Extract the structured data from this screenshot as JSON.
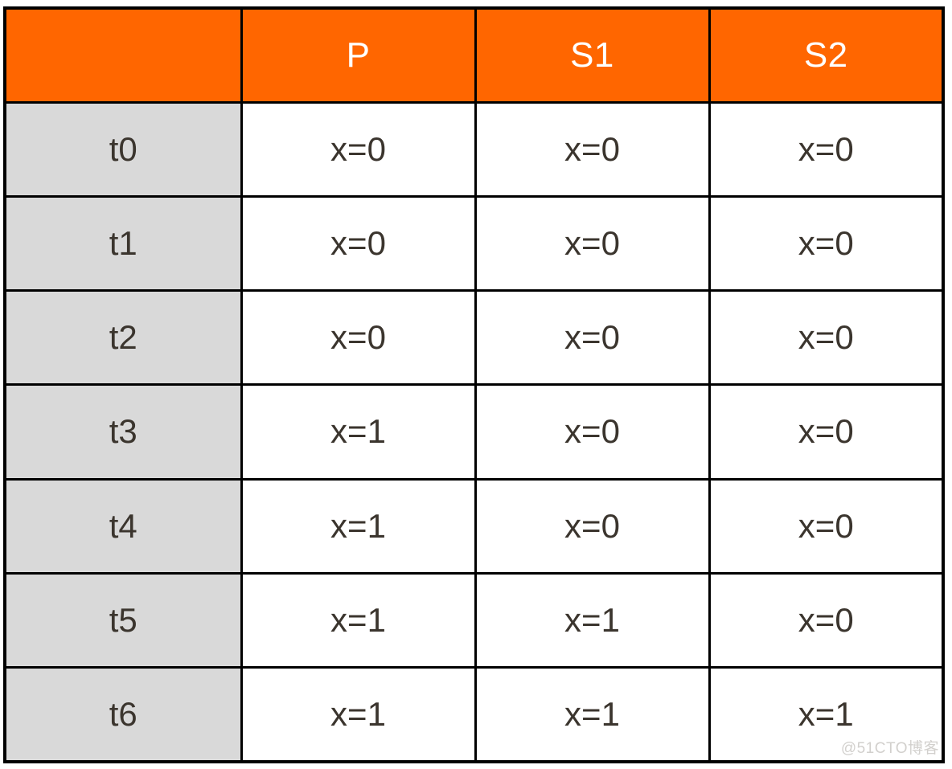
{
  "table": {
    "corner_label": "",
    "column_headers": [
      "P",
      "S1",
      "S2"
    ],
    "row_headers": [
      "t0",
      "t1",
      "t2",
      "t3",
      "t4",
      "t5",
      "t6"
    ],
    "rows": [
      {
        "time": "t0",
        "cells": [
          "x=0",
          "x=0",
          "x=0"
        ]
      },
      {
        "time": "t1",
        "cells": [
          "x=0",
          "x=0",
          "x=0"
        ]
      },
      {
        "time": "t2",
        "cells": [
          "x=0",
          "x=0",
          "x=0"
        ]
      },
      {
        "time": "t3",
        "cells": [
          "x=1",
          "x=0",
          "x=0"
        ]
      },
      {
        "time": "t4",
        "cells": [
          "x=1",
          "x=0",
          "x=0"
        ]
      },
      {
        "time": "t5",
        "cells": [
          "x=1",
          "x=1",
          "x=0"
        ]
      },
      {
        "time": "t6",
        "cells": [
          "x=1",
          "x=1",
          "x=1"
        ]
      }
    ]
  },
  "watermark": {
    "text": "@51CTO博客"
  },
  "colors": {
    "header_background": "#ff6600",
    "header_text": "#ffffff",
    "row_header_background": "#d9d9d9",
    "cell_background": "#ffffff",
    "cell_text": "#3b352e",
    "border": "#000000",
    "watermark_text": "#d2d0cd"
  }
}
